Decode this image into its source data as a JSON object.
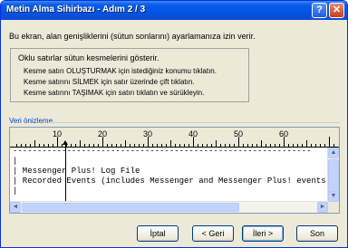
{
  "window": {
    "title": "Metin Alma Sihirbazı - Adım 2 / 3"
  },
  "titlebar": {
    "help_label": "?",
    "close_label": "✕"
  },
  "intro": "Bu ekran, alan genişliklerini (sütun sonlarını) ayarlamanıza izin verir.",
  "info": {
    "heading": "Oklu satırlar sütun kesmelerini gösterir.",
    "lines": [
      "Kesme satırı OLUŞTURMAK için istediğiniz konumu tıklatın.",
      "Kesme satırını SİLMEK için satır üzerinde çift tıklatın.",
      "Kesme satırını TAŞIMAK için satırı tıklatın ve sürükleyin."
    ]
  },
  "preview": {
    "label": "Veri önizleme",
    "ruler_labels": [
      "10",
      "20",
      "30",
      "40",
      "50",
      "60"
    ],
    "lines": [
      "-------------------------------------------------------------",
      "|",
      "| Messenger Plus! Log File",
      "| Recorded Events (includes Messenger and Messenger Plus! events)",
      "|"
    ]
  },
  "buttons": {
    "cancel": "İptal",
    "back": "< Geri",
    "next": "İleri >",
    "finish": "Son"
  }
}
